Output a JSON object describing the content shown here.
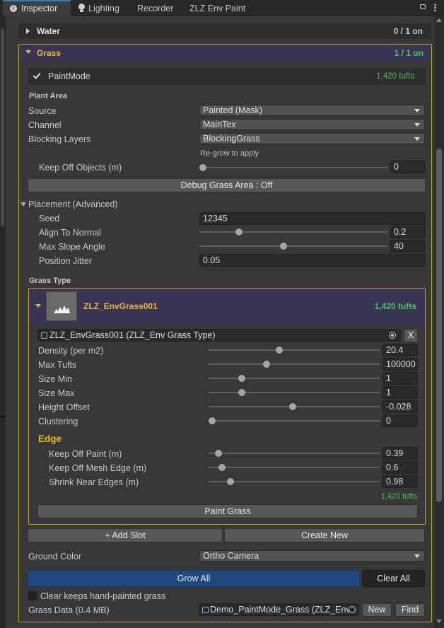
{
  "tabs": [
    {
      "label": "Inspector",
      "icon": "info-icon"
    },
    {
      "label": "Lighting",
      "icon": "bulb-icon"
    },
    {
      "label": "Recorder"
    },
    {
      "label": "ZLZ Env Paint"
    }
  ],
  "water": {
    "title": "Water",
    "status": "0 / 1 on"
  },
  "grass": {
    "title": "Grass",
    "status": "1 / 1 on"
  },
  "paint_mode": {
    "label": "PaintMode",
    "checked": true,
    "tufts": "1,420 tufts"
  },
  "plant_area": {
    "heading": "Plant Area",
    "source_label": "Source",
    "source_value": "Painted (Mask)",
    "channel_label": "Channel",
    "channel_value": "MainTex",
    "blocking_label": "Blocking Layers",
    "blocking_value": "BlockingGrass",
    "regrow_note": "Re-grow to apply",
    "keep_off_label": "Keep Off Objects (m)",
    "keep_off_value": "0",
    "keep_off_level": 0.0,
    "debug_button": "Debug Grass Area : Off"
  },
  "placement": {
    "heading": "Placement (Advanced)",
    "seed_label": "Seed",
    "seed_value": "12345",
    "align_label": "Align To Normal",
    "align_value": "0.2",
    "align_level": 0.2,
    "slope_label": "Max Slope Angle",
    "slope_value": "40",
    "slope_level": 0.444,
    "jitter_label": "Position Jitter",
    "jitter_value": "0.05"
  },
  "grass_type": {
    "heading": "Grass Type",
    "item_name": "ZLZ_EnvGrass001",
    "item_tufts": "1,420 tufts",
    "asset_ref": "ZLZ_EnvGrass001 (ZLZ_Env Grass Type)",
    "remove_label": "X",
    "density_label": "Density (per m2)",
    "density_value": "20.4",
    "density_level": 0.41,
    "max_tufts_label": "Max Tufts",
    "max_tufts_value": "100000",
    "max_tufts_level": 0.33,
    "size_min_label": "Size Min",
    "size_min_value": "1",
    "size_min_level": 0.18,
    "size_max_label": "Size Max",
    "size_max_value": "1",
    "size_max_level": 0.18,
    "height_label": "Height Offset",
    "height_value": "-0.028",
    "height_level": 0.49,
    "cluster_label": "Clustering",
    "cluster_value": "0",
    "cluster_level": 0.0,
    "edge_heading": "Edge",
    "keep_paint_label": "Keep Off Paint (m)",
    "keep_paint_value": "0.39",
    "keep_paint_level": 0.04,
    "keep_mesh_label": "Keep Off Mesh Edge (m)",
    "keep_mesh_value": "0.6",
    "keep_mesh_level": 0.06,
    "shrink_label": "Shrink Near Edges (m)",
    "shrink_value": "0.98",
    "shrink_level": 0.11,
    "edge_tufts": "1,420 tufts",
    "paint_button": "Paint Grass"
  },
  "slots": {
    "add_button": "+ Add Slot",
    "create_button": "Create New"
  },
  "ground": {
    "label": "Ground Color",
    "value": "Ortho Camera"
  },
  "actions": {
    "grow_all": "Grow All",
    "clear_all": "Clear All"
  },
  "clear_keep": {
    "label": "Clear keeps hand-painted grass",
    "checked": false
  },
  "grass_data": {
    "label": "Grass Data (0.4 MB)",
    "asset": "Demo_PaintMode_Grass (ZLZ_Env",
    "new_button": "New",
    "find_button": "Find"
  },
  "colors": {
    "accent_green": "#4cc25c",
    "accent_yellow": "#e8b82e",
    "header_purple": "#3a3556",
    "primary_blue": "#1f4a80"
  }
}
